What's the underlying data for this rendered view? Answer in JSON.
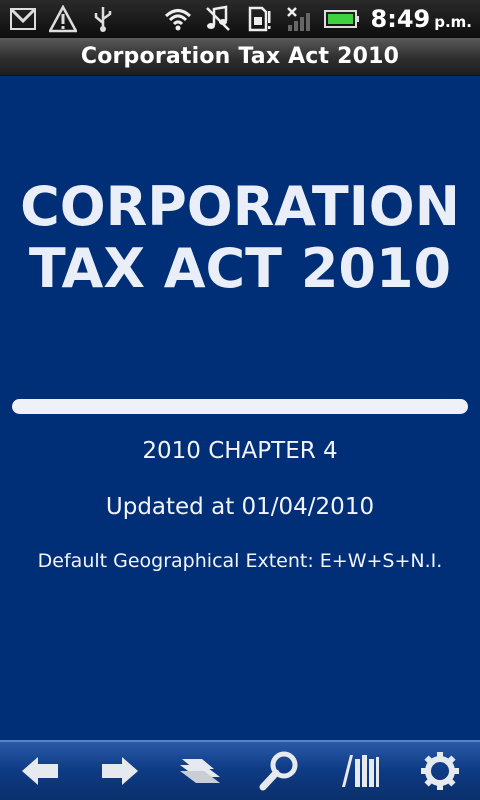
{
  "status_bar": {
    "icons_left": [
      "gmail-icon",
      "warning-icon",
      "usb-icon"
    ],
    "icons_right": [
      "wifi-icon",
      "music-off-icon",
      "sim-icon",
      "signal-icon",
      "battery-icon"
    ],
    "time": "8:49",
    "ampm": "p.m."
  },
  "title_bar": {
    "title": "Corporation Tax Act 2010"
  },
  "document": {
    "title_line1": "CORPORATION",
    "title_line2": "TAX ACT 2010",
    "chapter": "2010 CHAPTER 4",
    "updated": "Updated at 01/04/2010",
    "extent": "Default Geographical Extent: E+W+S+N.I."
  },
  "toolbar": {
    "buttons": [
      "back-arrow-icon",
      "forward-arrow-icon",
      "contents-icon",
      "search-icon",
      "library-icon",
      "settings-icon"
    ]
  },
  "colors": {
    "background": "#002f78",
    "toolbar": "#0f3c86",
    "title_bar": "#3a3a3a"
  }
}
